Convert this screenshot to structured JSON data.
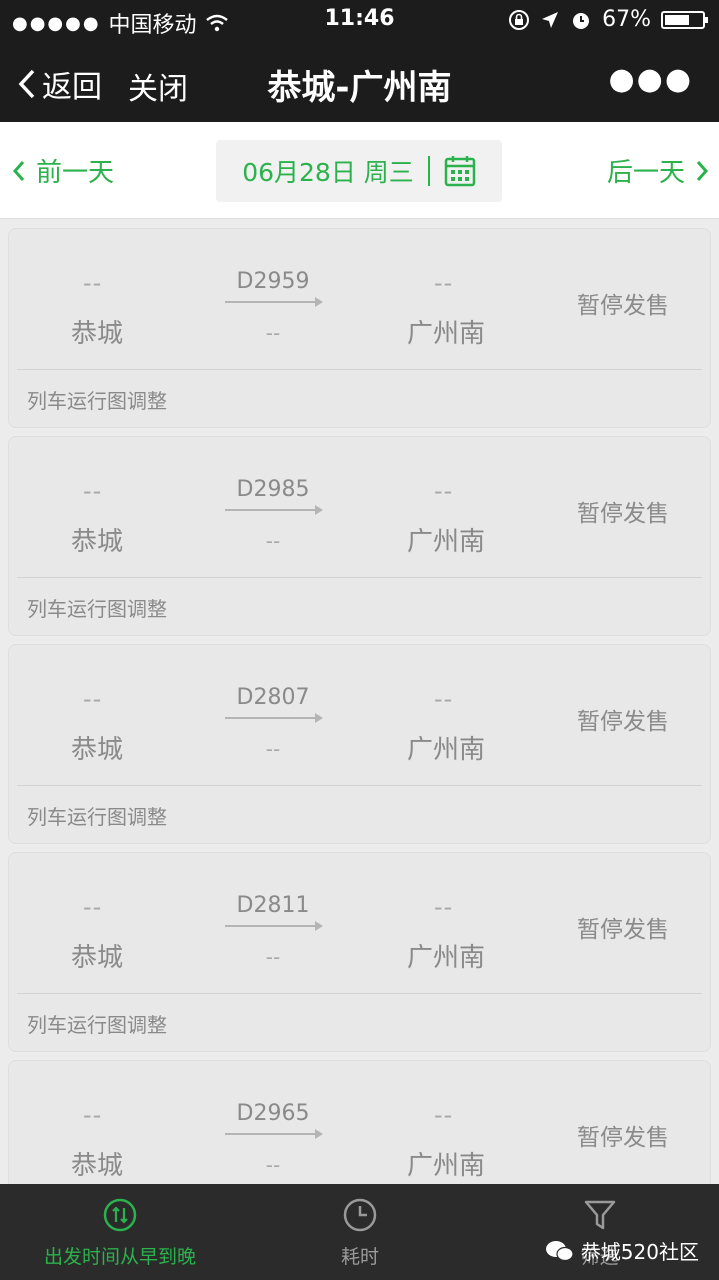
{
  "statusbar": {
    "carrier": "中国移动",
    "time": "11:46",
    "battery": "67%",
    "battery_level": 0.67
  },
  "nav": {
    "back_label": "返回",
    "close_label": "关闭",
    "title": "恭城-广州南"
  },
  "datebar": {
    "prev_label": "前一天",
    "date_label": "06月28日 周三",
    "next_label": "后一天"
  },
  "trains": [
    {
      "dep_time": "--",
      "dep_station": "恭城",
      "train_no": "D2959",
      "duration": "--",
      "arr_time": "--",
      "arr_station": "广州南",
      "status": "暂停发售",
      "note": "列车运行图调整"
    },
    {
      "dep_time": "--",
      "dep_station": "恭城",
      "train_no": "D2985",
      "duration": "--",
      "arr_time": "--",
      "arr_station": "广州南",
      "status": "暂停发售",
      "note": "列车运行图调整"
    },
    {
      "dep_time": "--",
      "dep_station": "恭城",
      "train_no": "D2807",
      "duration": "--",
      "arr_time": "--",
      "arr_station": "广州南",
      "status": "暂停发售",
      "note": "列车运行图调整"
    },
    {
      "dep_time": "--",
      "dep_station": "恭城",
      "train_no": "D2811",
      "duration": "--",
      "arr_time": "--",
      "arr_station": "广州南",
      "status": "暂停发售",
      "note": "列车运行图调整"
    },
    {
      "dep_time": "--",
      "dep_station": "恭城",
      "train_no": "D2965",
      "duration": "--",
      "arr_time": "--",
      "arr_station": "广州南",
      "status": "暂停发售",
      "note": ""
    }
  ],
  "tabs": {
    "sort_depart": "出发时间从早到晚",
    "duration": "耗时",
    "filter": "筛选"
  },
  "watermark": {
    "text": "恭城520社区"
  },
  "colors": {
    "accent": "#2bb24c",
    "dark": "#1c1c1c"
  }
}
